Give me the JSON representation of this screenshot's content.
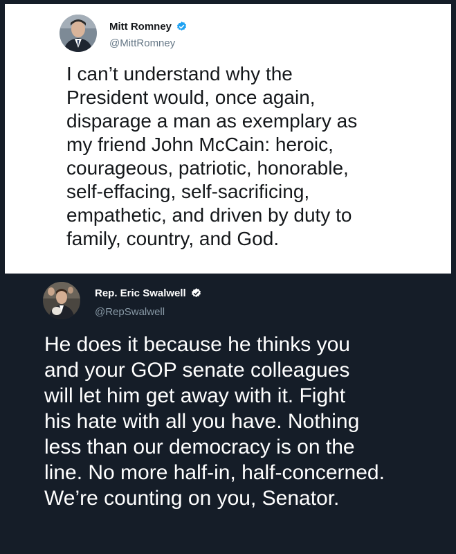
{
  "tweets": [
    {
      "author_name": "Mitt Romney",
      "handle": "@MittRomney",
      "verified": true,
      "avatar_icon": "profile-photo",
      "text": "I can’t understand why the\nPresident would, once again,\ndisparage a man as exemplary as\nmy friend John McCain: heroic,\ncourageous, patriotic, honorable,\nself-effacing, self-sacrificing,\nempathetic, and driven by duty to\nfamily, country, and God.",
      "theme": "light",
      "colors": {
        "background": "#ffffff",
        "text": "#14171a",
        "handle": "#657786",
        "verified": "#1da1f2"
      }
    },
    {
      "author_name": "Rep. Eric Swalwell",
      "handle": "@RepSwalwell",
      "verified": true,
      "avatar_icon": "profile-photo",
      "text": "He does it because he thinks you\nand your GOP senate colleagues\nwill let him get away with it. Fight\nhis hate with all you have. Nothing\nless than our democracy is on the\nline. No more half-in, half-concerned.\nWe’re counting on you,  Senator.",
      "theme": "dark",
      "colors": {
        "background": "#151d28",
        "text": "#ffffff",
        "handle": "#8899a6",
        "verified": "#ffffff"
      }
    }
  ]
}
